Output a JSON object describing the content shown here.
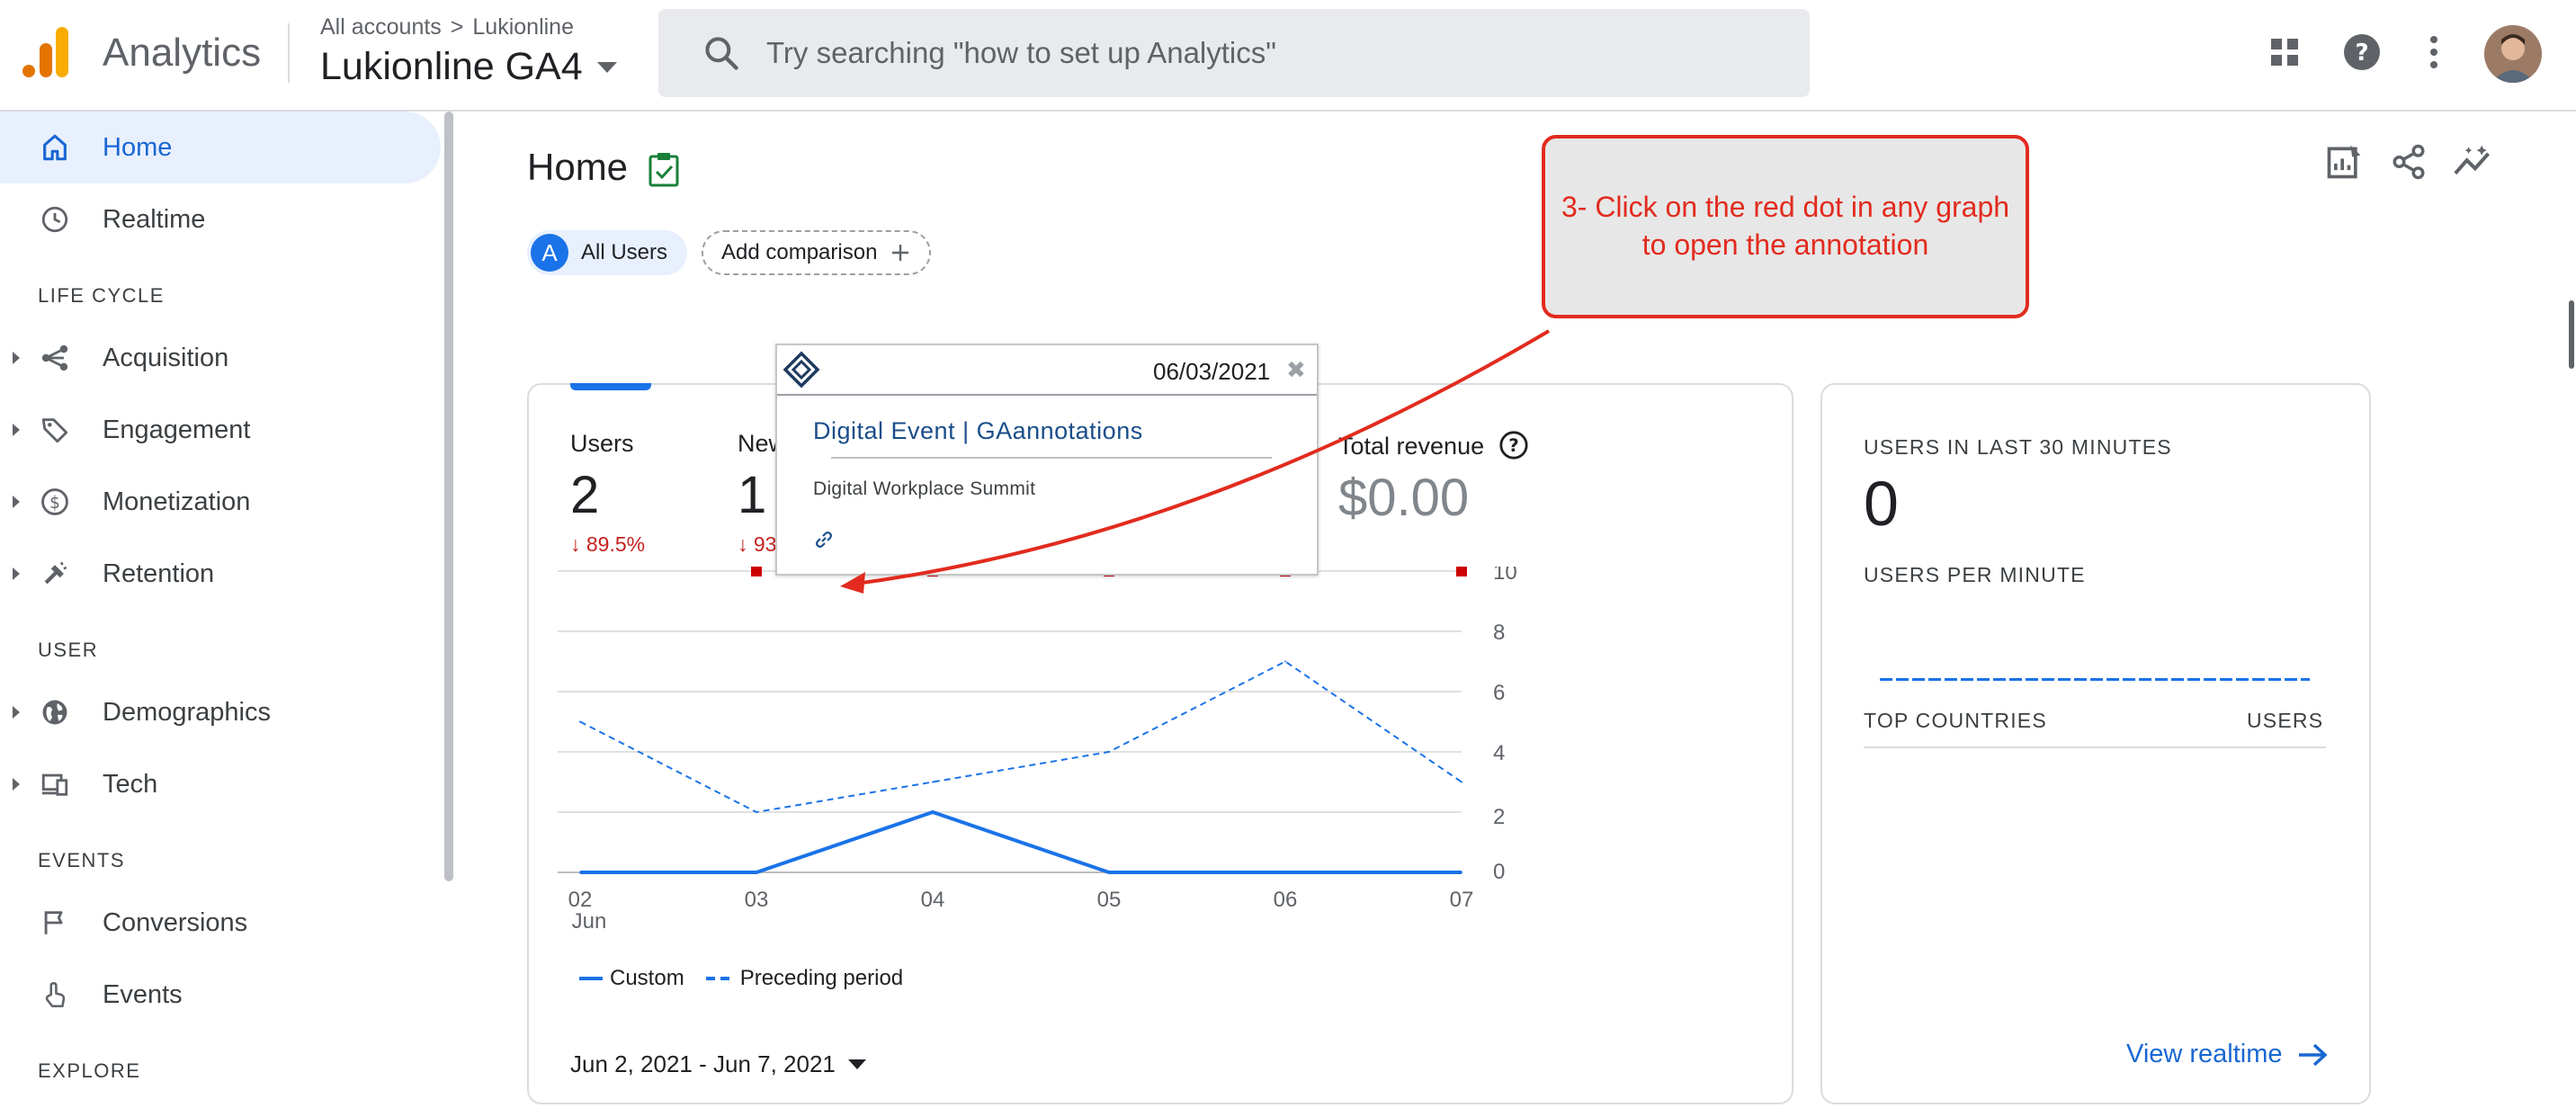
{
  "colors": {
    "brand_orange": "#f9ab00",
    "brand_dark_orange": "#e37400",
    "accent_blue": "#1a73e8",
    "active_bg": "#e8f0fe",
    "negative_red": "#c5221f",
    "callout_red": "#e22b1e",
    "annotation_dot": "#cc0000"
  },
  "topbar": {
    "logo_icon": "analytics-logo",
    "app_title": "Analytics",
    "breadcrumb": {
      "account": "All accounts",
      "separator": ">",
      "property_parent": "Lukionline"
    },
    "property_name": "Lukionline GA4",
    "search": {
      "icon": "search-icon",
      "placeholder": "Try searching \"how to set up Analytics\""
    },
    "icons": [
      "apps-grid-icon",
      "help-icon",
      "more-vert-icon",
      "user-avatar"
    ]
  },
  "sidebar": {
    "items": [
      {
        "label": "Home",
        "icon": "home-icon",
        "active": true
      },
      {
        "label": "Realtime",
        "icon": "clock-icon"
      }
    ],
    "sections": [
      {
        "title": "LIFE CYCLE",
        "items": [
          {
            "label": "Acquisition",
            "icon": "acquisition-icon"
          },
          {
            "label": "Engagement",
            "icon": "tag-icon"
          },
          {
            "label": "Monetization",
            "icon": "dollar-icon"
          },
          {
            "label": "Retention",
            "icon": "retention-icon"
          }
        ]
      },
      {
        "title": "USER",
        "items": [
          {
            "label": "Demographics",
            "icon": "globe-icon"
          },
          {
            "label": "Tech",
            "icon": "devices-icon"
          }
        ]
      },
      {
        "title": "EVENTS",
        "items": [
          {
            "label": "Conversions",
            "icon": "flag-icon"
          },
          {
            "label": "Events",
            "icon": "touch-icon"
          }
        ]
      },
      {
        "title": "EXPLORE",
        "items": []
      }
    ]
  },
  "main": {
    "page_title": "Home",
    "header_actions": [
      "customize-report-icon",
      "share-icon",
      "insights-icon"
    ],
    "comparison": {
      "chip_letter": "A",
      "chip_label": "All Users",
      "add_label": "Add comparison"
    },
    "metrics": [
      {
        "label": "Users",
        "value": "2",
        "change": "↓ 89.5%"
      },
      {
        "label": "New users",
        "value": "1",
        "change": "↓ 93"
      },
      {
        "label": "Total revenue",
        "value": "$0.00"
      }
    ],
    "legend": {
      "custom": "Custom",
      "preceding": "Preceding period"
    },
    "date_range": "Jun 2, 2021 - Jun 7, 2021"
  },
  "chart_data": {
    "type": "line",
    "x": [
      "02 Jun",
      "03",
      "04",
      "05",
      "06",
      "07"
    ],
    "x_ticks": [
      "02",
      "03",
      "04",
      "05",
      "06",
      "07"
    ],
    "x_sub_label": "Jun",
    "ylim": [
      0,
      10
    ],
    "y_ticks": [
      0,
      2,
      4,
      6,
      8,
      10
    ],
    "grid": true,
    "series": [
      {
        "name": "Custom",
        "style": "solid",
        "values": [
          0,
          0,
          2,
          0,
          0,
          0
        ]
      },
      {
        "name": "Preceding period",
        "style": "dashed",
        "values": [
          5,
          2,
          3,
          4,
          7,
          3
        ]
      }
    ],
    "annotation_markers": [
      "03",
      "04",
      "05",
      "06",
      "07"
    ]
  },
  "annotation": {
    "date": "06/03/2021",
    "close": "✖",
    "title": "Digital Event | GAannotations",
    "description": "Digital Workplace Summit",
    "link_icon": "link-icon"
  },
  "callout": {
    "text_line1": "3- Click on the red dot in any graph",
    "text_line2": "to open the annotation"
  },
  "realtime": {
    "users_last_30_label": "USERS IN LAST 30 MINUTES",
    "users_last_30_value": "0",
    "users_per_minute_label": "USERS PER MINUTE",
    "top_countries_label": "TOP COUNTRIES",
    "users_col_label": "USERS",
    "view_link": "View realtime"
  }
}
